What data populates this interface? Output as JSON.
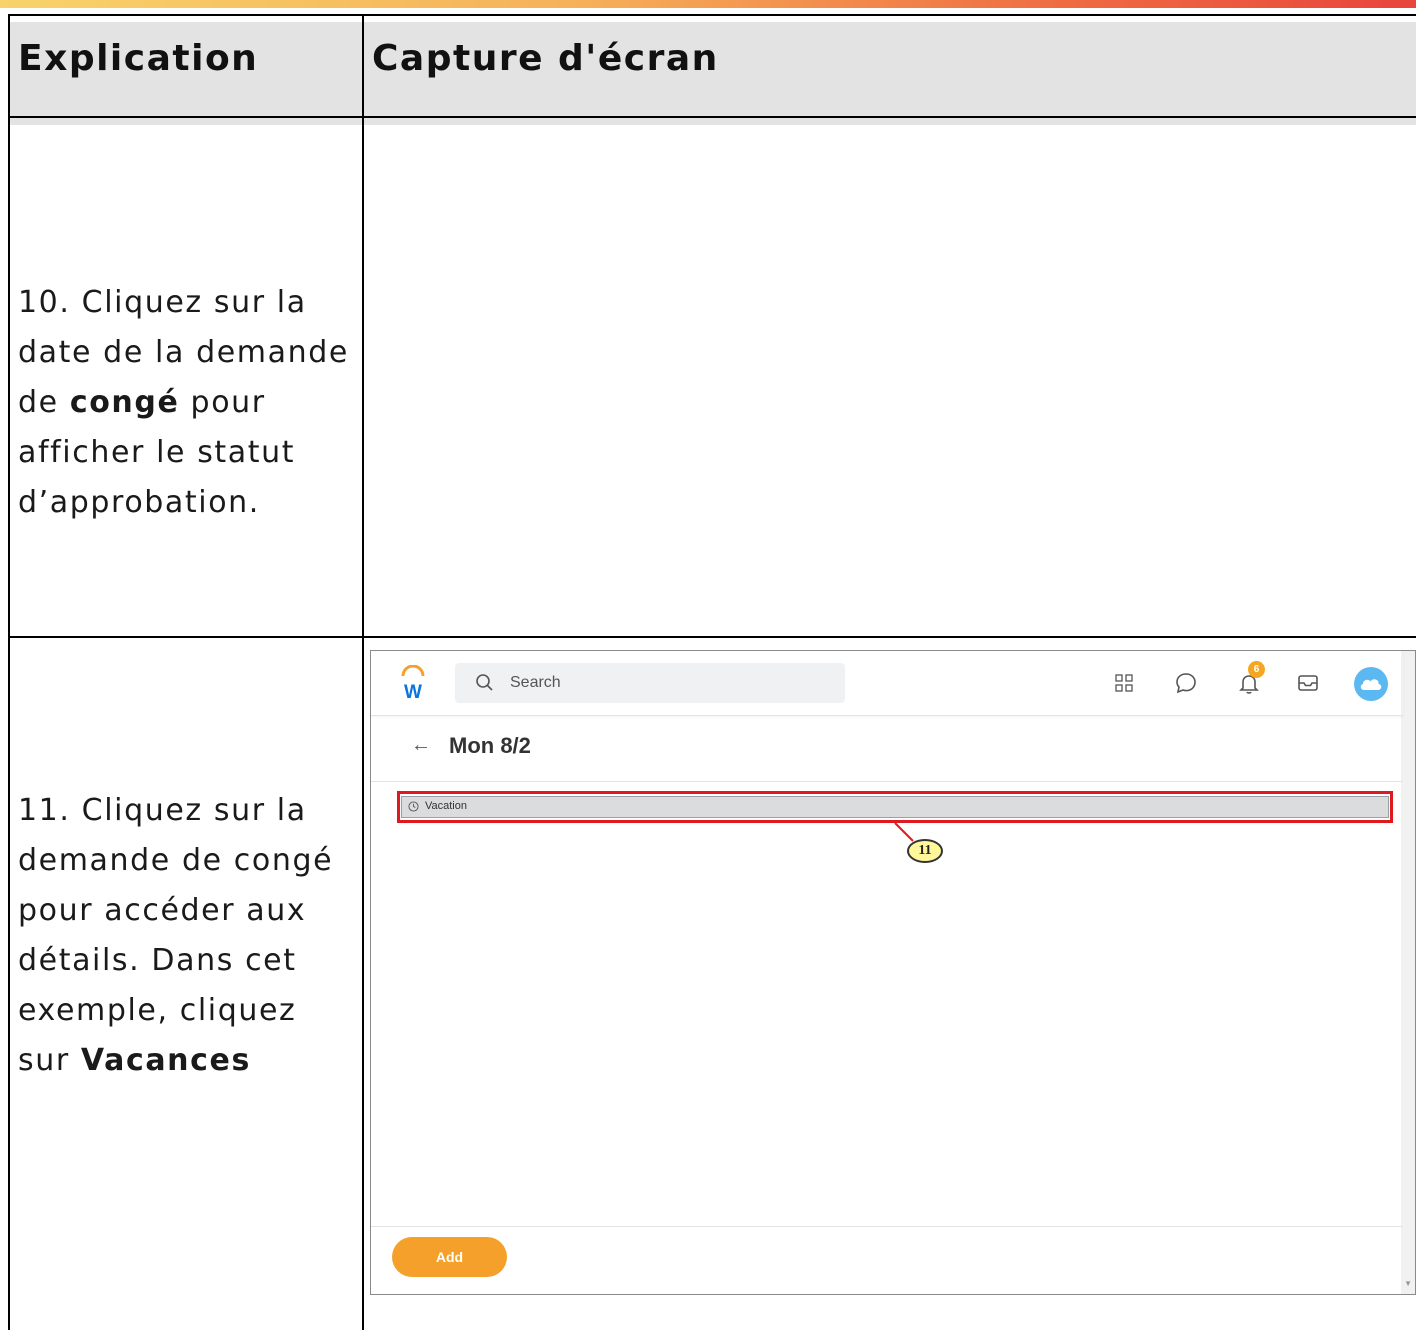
{
  "table": {
    "header": {
      "col1": "Explication",
      "col2": "Capture d'écran"
    },
    "rows": [
      {
        "step_part1": "10. Cliquez sur la date de la demande de ",
        "step_bold": "congé",
        "step_part2": " pour afficher le statut d’approbation."
      },
      {
        "step_part1": "11. Cliquez sur la demande de congé pour accéder aux détails. Dans cet exemple, cliquez sur ",
        "step_bold": "Vacances",
        "step_part2": ""
      }
    ]
  },
  "screenshot": {
    "logo_letter": "W",
    "search_placeholder": "Search",
    "notification_count": "6",
    "page_title": "Mon 8/2",
    "back_arrow": "←",
    "event_label": "Vacation",
    "callout_number": "11",
    "add_button": "Add",
    "icons": [
      "search-icon",
      "apps-grid-icon",
      "chat-icon",
      "bell-icon",
      "inbox-icon",
      "avatar",
      "clock-icon",
      "arrow-left-icon"
    ],
    "colors": {
      "brand_orange": "#f5a02a",
      "callout_red": "#e0191e",
      "avatar_blue": "#5bb8f0",
      "logo_blue": "#0875e1"
    }
  }
}
